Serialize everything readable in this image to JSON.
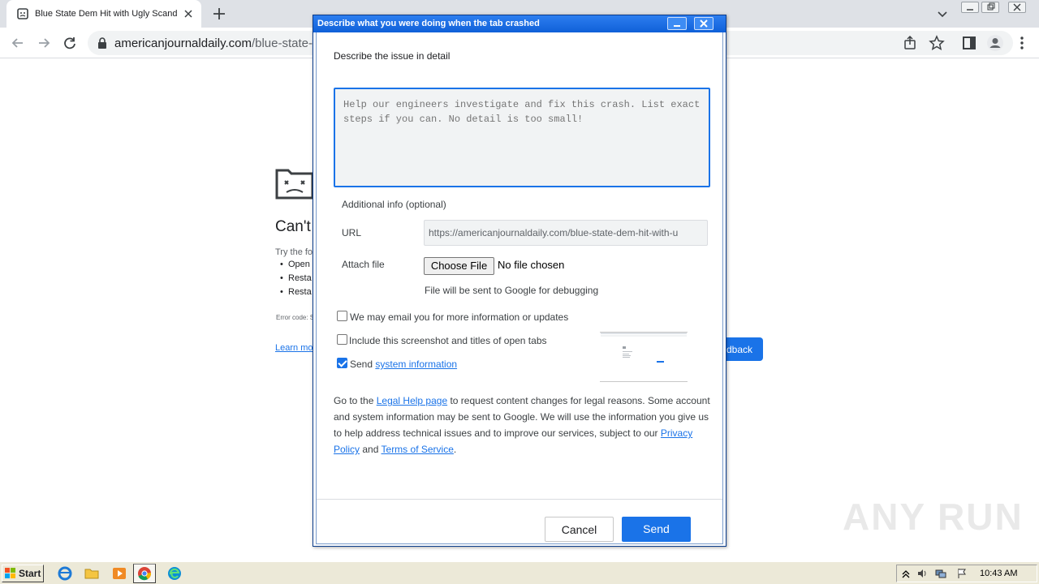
{
  "browser": {
    "tab_title": "Blue State Dem Hit with Ugly Scanda",
    "url_host": "americanjournaldaily.com",
    "url_path": "/blue-state-dem"
  },
  "crash_page": {
    "title": "Can't",
    "try_text": "Try the fo",
    "items": [
      "Open",
      "Resta",
      "Resta"
    ],
    "error_code": "Error code: S",
    "learn_more": "Learn mor",
    "feedback_button": "dback"
  },
  "dialog": {
    "title": "Describe what you were doing when the tab crashed",
    "describe_label": "Describe the issue in detail",
    "description_placeholder": "Help our engineers investigate and fix this crash. List exact steps if you can. No detail is too small!",
    "additional_label": "Additional info (optional)",
    "url_label": "URL",
    "url_value": "https://americanjournaldaily.com/blue-state-dem-hit-with-u",
    "attach_label": "Attach file",
    "choose_file_label": "Choose File",
    "no_file_label": "No file chosen",
    "attach_note": "File will be sent to Google for debugging",
    "email_checkbox": {
      "label": "We may email you for more information or updates",
      "checked": false
    },
    "screenshot_checkbox": {
      "label": "Include this screenshot and titles of open tabs",
      "checked": false
    },
    "sysinfo_checkbox": {
      "prefix": "Send",
      "link": "system information",
      "checked": true
    },
    "legal": {
      "t1": "Go to the",
      "legal_link": "Legal Help page",
      "t2": "to request content changes for legal reasons. Some account and system information may be sent to Google. We will use the information you give us to help address technical issues and to improve our services, subject to our",
      "privacy_link": "Privacy Policy",
      "t3": "and",
      "terms_link": "Terms of Service",
      "t4": "."
    },
    "cancel_label": "Cancel",
    "send_label": "Send"
  },
  "watermark": "ANY RUN",
  "taskbar": {
    "start_label": "Start",
    "clock": "10:43 AM"
  },
  "colors": {
    "accent": "#1a73e8",
    "titlebar": "#0f60d8",
    "taskbar": "#ece9d8"
  }
}
